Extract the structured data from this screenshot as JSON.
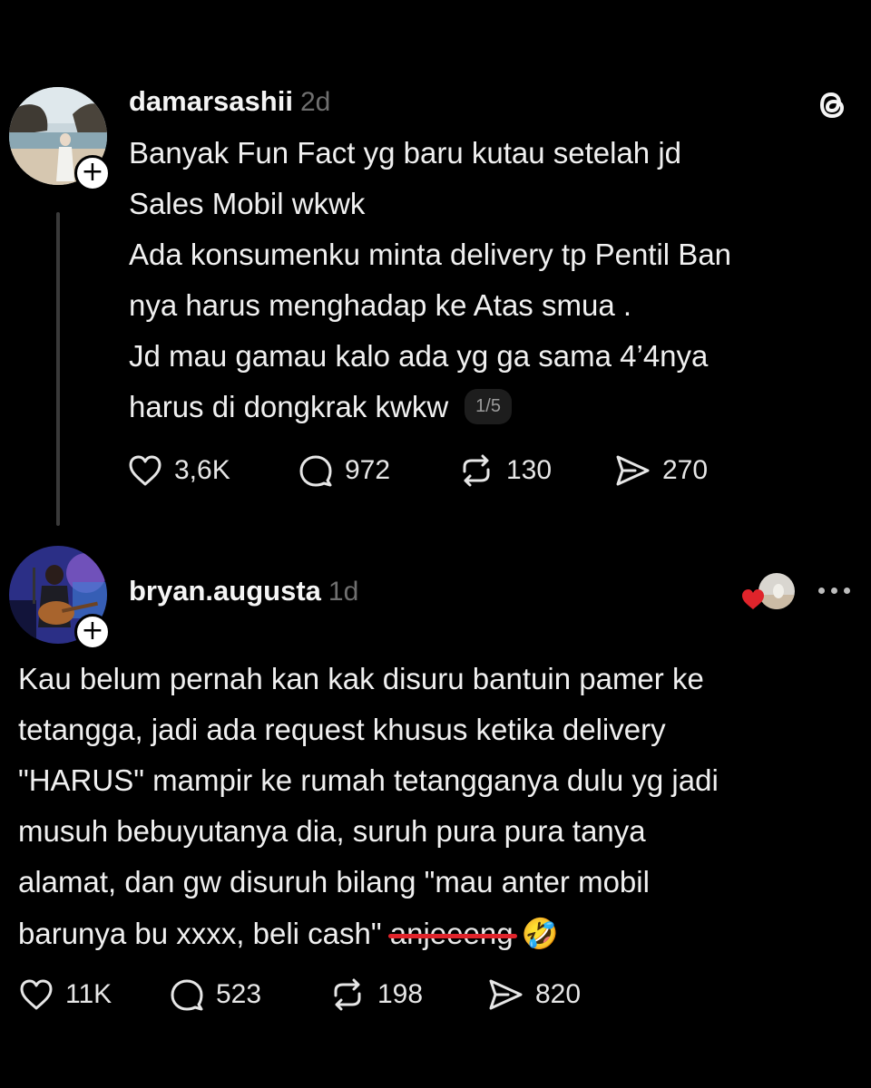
{
  "post1": {
    "username": "damarsashii",
    "time": "2d",
    "lines": [
      "Banyak Fun Fact yg baru kutau setelah jd",
      "Sales Mobil wkwk",
      "Ada konsumenku minta delivery tp Pentil Ban",
      "nya harus menghadap ke Atas smua .",
      "Jd mau gamau kalo ada yg ga sama 4’4nya",
      "harus di dongkrak kwkw"
    ],
    "page_badge": "1/5",
    "stats": {
      "likes": "3,6K",
      "replies": "972",
      "reposts": "130",
      "shares": "270"
    }
  },
  "post2": {
    "username": "bryan.augusta",
    "time": "1d",
    "lines": [
      "Kau belum pernah kan kak disuru bantuin pamer ke",
      "tetangga, jadi ada request khusus ketika delivery",
      "\"HARUS\" mampir ke rumah tetangganya dulu yg jadi",
      "musuh bebuyutanya dia, suruh pura pura tanya",
      "alamat, dan gw disuruh bilang \"mau anter mobil"
    ],
    "last_line_text": "barunya bu xxxx, beli cash\"",
    "strikethrough_text": "anjeeeng",
    "emoji": "🤣",
    "stats": {
      "likes": "11K",
      "replies": "523",
      "reposts": "198",
      "shares": "820"
    }
  },
  "colors": {
    "background": "#000000",
    "text": "#f3f3f3",
    "muted": "#6f6f6f",
    "heart": "#e0242b"
  }
}
